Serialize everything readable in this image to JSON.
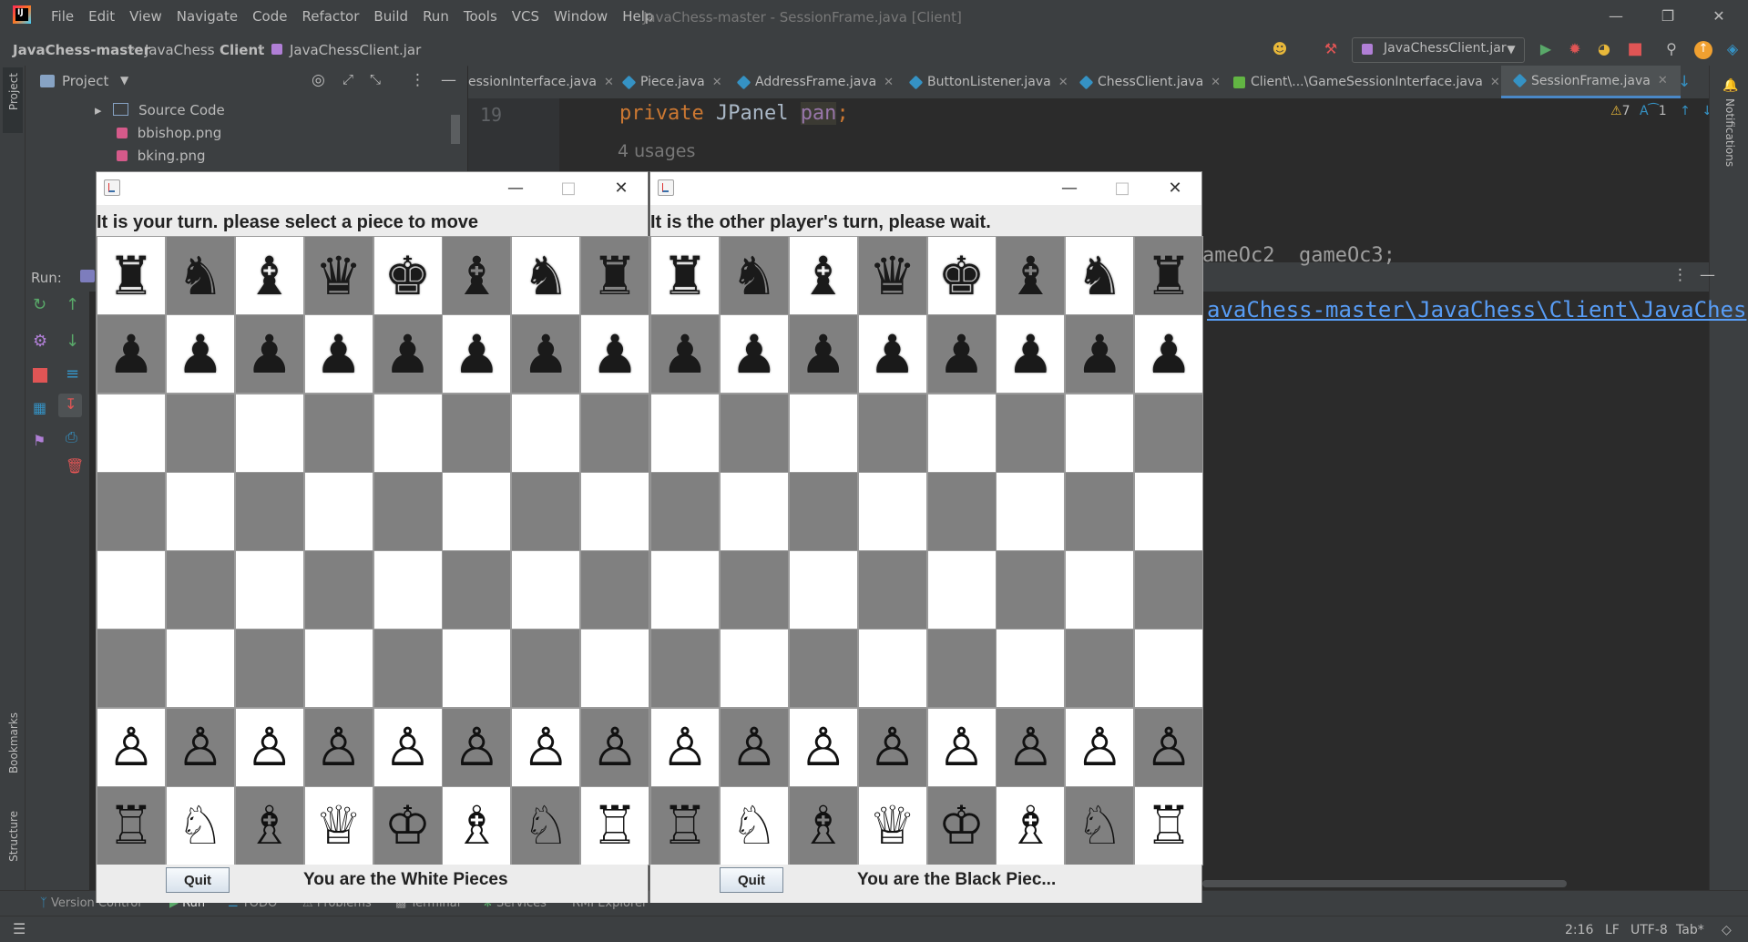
{
  "ide": {
    "window_title": "JavaChess-master - SessionFrame.java [Client]",
    "menu": [
      "File",
      "Edit",
      "View",
      "Navigate",
      "Code",
      "Refactor",
      "Build",
      "Run",
      "Tools",
      "VCS",
      "Window",
      "Help"
    ],
    "breadcrumbs": [
      "JavaChess-master",
      "JavaChess",
      "Client",
      "JavaChessClient.jar"
    ],
    "run_config": "JavaChessClient.jar",
    "project_panel": {
      "title": "Project",
      "tree": [
        {
          "label": "Source Code",
          "type": "folder"
        },
        {
          "label": "bbishop.png",
          "type": "image"
        },
        {
          "label": "bking.png",
          "type": "image"
        }
      ]
    },
    "tabs": [
      {
        "label": "essionInterface.java",
        "active": false
      },
      {
        "label": "Piece.java",
        "active": false
      },
      {
        "label": "AddressFrame.java",
        "active": false
      },
      {
        "label": "ButtonListener.java",
        "active": false
      },
      {
        "label": "ChessClient.java",
        "active": false
      },
      {
        "label": "Client\\...\\GameSessionInterface.java",
        "active": false
      },
      {
        "label": "SessionFrame.java",
        "active": true
      }
    ],
    "editor": {
      "line_number": "19",
      "code": {
        "kw": "private ",
        "type": "JPanel ",
        "ident": "pan",
        "semi": ";"
      },
      "usages": "4 usages",
      "inspections": {
        "warnings": "7",
        "typos": "1"
      }
    },
    "run_panel": {
      "label": "Run:",
      "console_path": "avaChess-master\\JavaChess\\Client\\JavaChes",
      "code_fragment": "ameOc2  gameOc3;"
    },
    "left_strip": {
      "project": "Project",
      "bookmarks": "Bookmarks",
      "structure": "Structure"
    },
    "right_strip": {
      "notifications": "Notifications"
    },
    "bottom_tabs": [
      "Version Control",
      "Run",
      "TODO",
      "Problems",
      "Terminal",
      "Services",
      "RMI Explorer"
    ],
    "status": {
      "position": "2:16",
      "line_sep": "LF",
      "encoding": "UTF-8",
      "indent": "Tab*"
    }
  },
  "chess_windows": [
    {
      "status": "It is your turn. please select a piece to move",
      "quit": "Quit",
      "footer": "You are the White Pieces",
      "board": [
        [
          "♜",
          "♞",
          "♝",
          "♛",
          "♚",
          "♝",
          "♞",
          "♜"
        ],
        [
          "♟",
          "♟",
          "♟",
          "♟",
          "♟",
          "♟",
          "♟",
          "♟"
        ],
        [
          "",
          "",
          "",
          "",
          "",
          "",
          "",
          ""
        ],
        [
          "",
          "",
          "",
          "",
          "",
          "",
          "",
          ""
        ],
        [
          "",
          "",
          "",
          "",
          "",
          "",
          "",
          ""
        ],
        [
          "",
          "",
          "",
          "",
          "",
          "",
          "",
          ""
        ],
        [
          "♙",
          "♙",
          "♙",
          "♙",
          "♙",
          "♙",
          "♙",
          "♙"
        ],
        [
          "♖",
          "♘",
          "♗",
          "♕",
          "♔",
          "♗",
          "♘",
          "♖"
        ]
      ]
    },
    {
      "status": "It is the other player's turn, please wait.",
      "quit": "Quit",
      "footer": "You are the Black Piec...",
      "board": [
        [
          "♜",
          "♞",
          "♝",
          "♛",
          "♚",
          "♝",
          "♞",
          "♜"
        ],
        [
          "♟",
          "♟",
          "♟",
          "♟",
          "♟",
          "♟",
          "♟",
          "♟"
        ],
        [
          "",
          "",
          "",
          "",
          "",
          "",
          "",
          ""
        ],
        [
          "",
          "",
          "",
          "",
          "",
          "",
          "",
          ""
        ],
        [
          "",
          "",
          "",
          "",
          "",
          "",
          "",
          ""
        ],
        [
          "",
          "",
          "",
          "",
          "",
          "",
          "",
          ""
        ],
        [
          "♙",
          "♙",
          "♙",
          "♙",
          "♙",
          "♙",
          "♙",
          "♙"
        ],
        [
          "♖",
          "♘",
          "♗",
          "♕",
          "♔",
          "♗",
          "♘",
          "♖"
        ]
      ]
    }
  ]
}
